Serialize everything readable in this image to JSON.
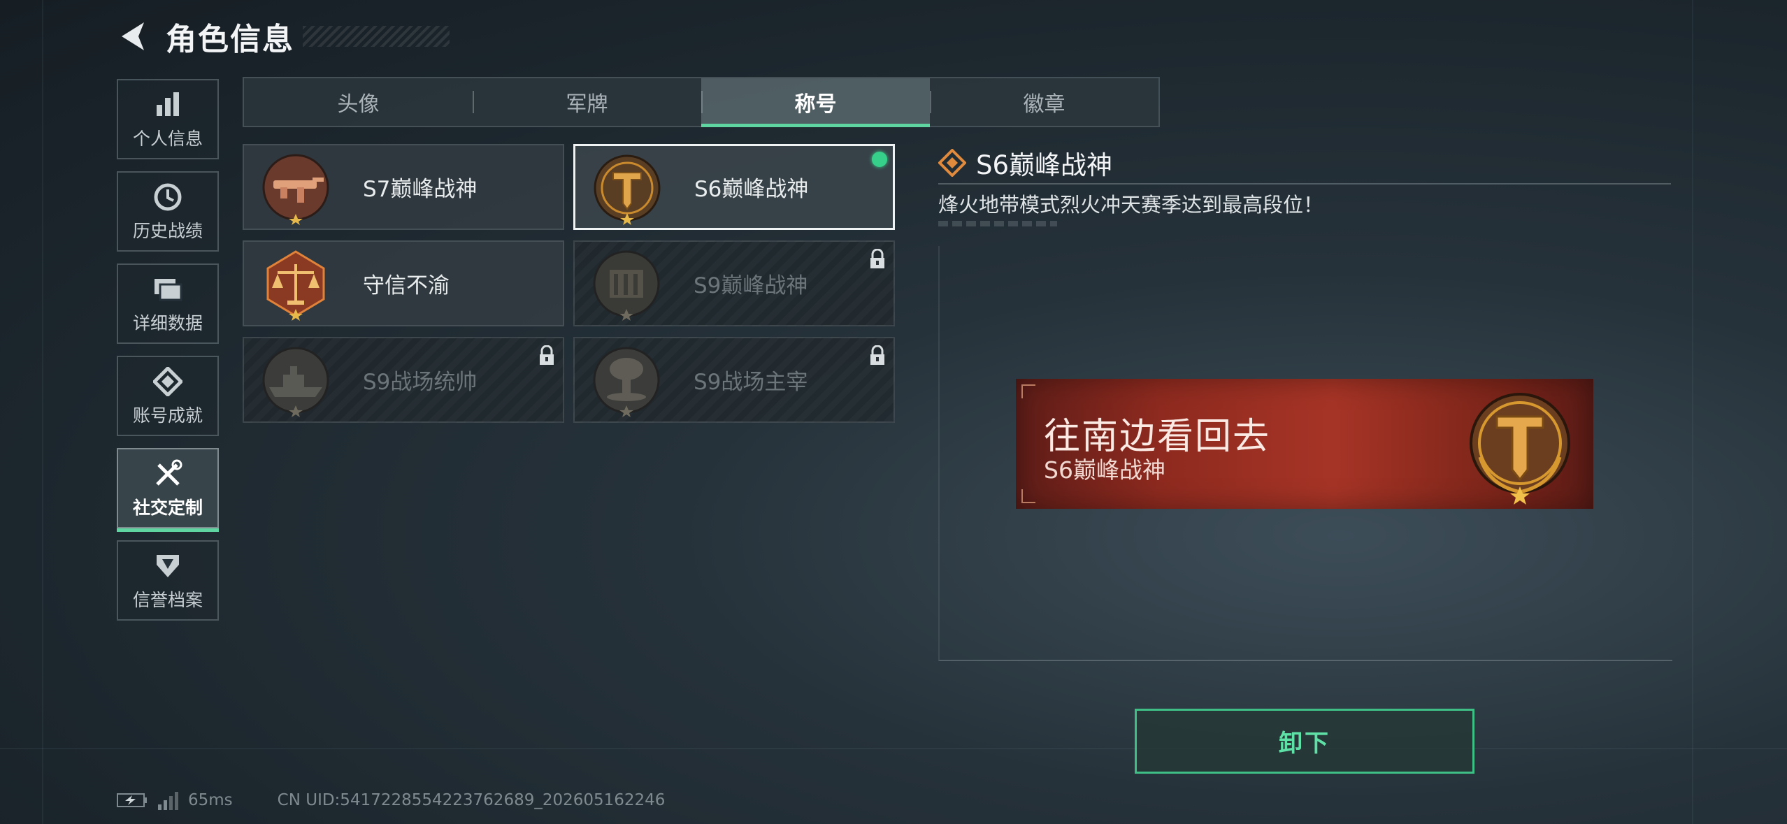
{
  "header": {
    "title": "角色信息",
    "back_icon": "back-arrow-icon"
  },
  "nav": {
    "items": [
      {
        "label": "个人信息",
        "icon": "bar-chart-icon",
        "active": false
      },
      {
        "label": "历史战绩",
        "icon": "clock-icon",
        "active": false
      },
      {
        "label": "详细数据",
        "icon": "folder-icon",
        "active": false
      },
      {
        "label": "账号成就",
        "icon": "achievement-icon",
        "active": false
      },
      {
        "label": "社交定制",
        "icon": "tools-icon",
        "active": true
      },
      {
        "label": "信誉档案",
        "icon": "credit-shield-icon",
        "active": false
      }
    ]
  },
  "tabs": [
    {
      "label": "头像",
      "active": false
    },
    {
      "label": "军牌",
      "active": false
    },
    {
      "label": "称号",
      "active": true
    },
    {
      "label": "徽章",
      "active": false
    }
  ],
  "titles": [
    {
      "label": "S7巅峰战神",
      "emblem": "rifle-emblem",
      "locked": false,
      "selected": false,
      "equipped": false
    },
    {
      "label": "S6巅峰战神",
      "emblem": "t-shield-emblem",
      "locked": false,
      "selected": true,
      "equipped": true
    },
    {
      "label": "守信不渝",
      "emblem": "scales-emblem",
      "locked": false,
      "selected": false,
      "equipped": false
    },
    {
      "label": "S9巅峰战神",
      "emblem": "ruins-emblem",
      "locked": true,
      "selected": false,
      "equipped": false
    },
    {
      "label": "S9战场统帅",
      "emblem": "warship-emblem",
      "locked": true,
      "selected": false,
      "equipped": false
    },
    {
      "label": "S9战场主宰",
      "emblem": "mushroom-cloud-emblem",
      "locked": true,
      "selected": false,
      "equipped": false
    }
  ],
  "detail": {
    "title": "S6巅峰战神",
    "description": "烽火地带模式烈火冲天赛季达到最高段位！"
  },
  "banner": {
    "player_name": "往南边看回去",
    "title": "S6巅峰战神"
  },
  "actions": {
    "unequip_label": "卸下"
  },
  "status": {
    "ping": "65ms",
    "uid": "CN UID:5417228554223762689_202605162246"
  },
  "colors": {
    "accent": "#5fd6a2",
    "equipped": "#36d08a",
    "banner_red": "#a63426",
    "gold": "#c98a2e"
  }
}
